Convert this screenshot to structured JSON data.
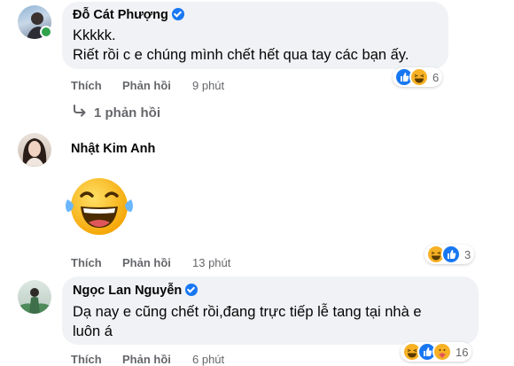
{
  "comments": [
    {
      "author": "Đỗ Cát Phượng",
      "verified": true,
      "online": true,
      "lines": [
        "Kkkkk.",
        "Riết rồi c e chúng mình chết hết qua tay các bạn ấy."
      ],
      "like_label": "Thích",
      "reply_label": "Phản hồi",
      "time": "9 phút",
      "reaction_count": "6",
      "reactions": [
        "like-icon",
        "haha-icon"
      ]
    },
    {
      "author": "Nhật Kim Anh",
      "verified": false,
      "sticker": "laughing-tears-sticker",
      "like_label": "Thích",
      "reply_label": "Phản hồi",
      "time": "13 phút",
      "reaction_count": "3",
      "reactions": [
        "haha-icon",
        "like-icon"
      ]
    },
    {
      "author": "Ngọc Lan Nguyễn",
      "verified": true,
      "lines": [
        "Dạ nay e cũng chết rồi,đang trực tiếp lễ tang tại nhà e",
        "luôn á"
      ],
      "like_label": "Thích",
      "reply_label": "Phản hồi",
      "time": "6 phút",
      "reaction_count": "16",
      "reactions": [
        "haha-icon",
        "like-icon",
        "care-icon"
      ]
    }
  ],
  "replies_link": "1 phản hồi",
  "colors": {
    "bubble": "#f0f2f5",
    "secondary_text": "#65676b",
    "link": "#1877f2",
    "online": "#31a24c"
  }
}
